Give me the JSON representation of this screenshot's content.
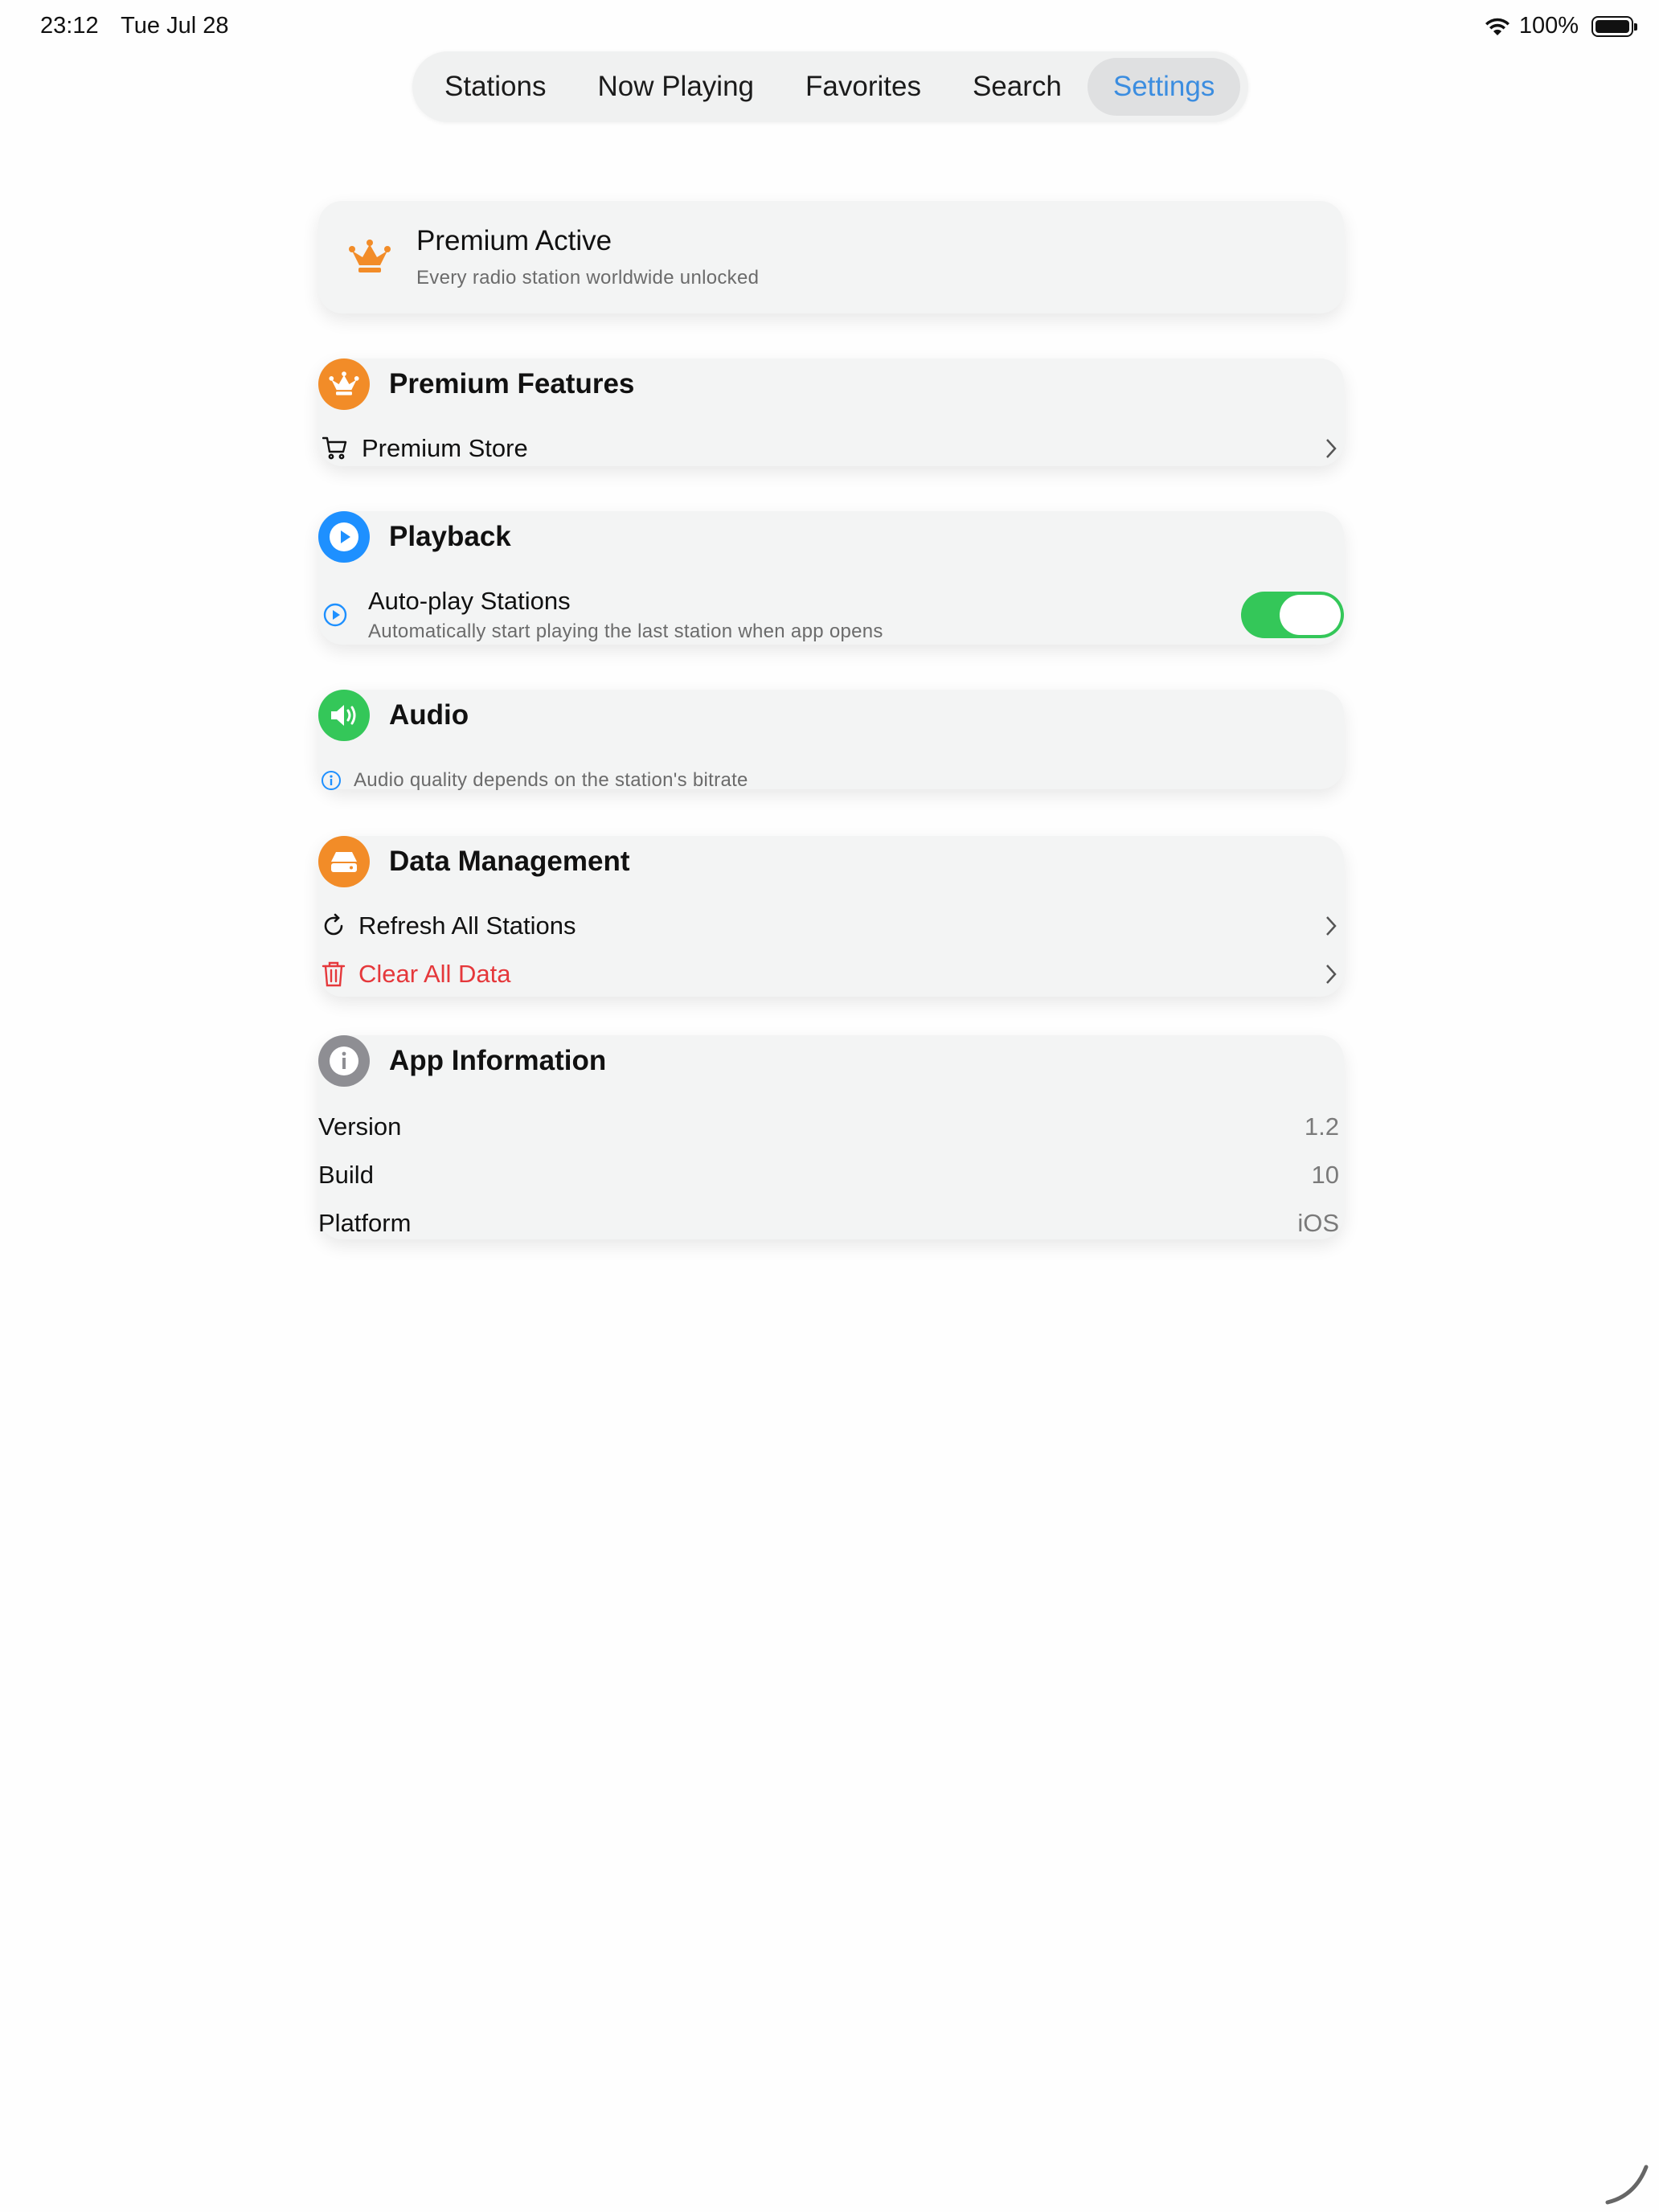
{
  "status_bar": {
    "time": "23:12",
    "date": "Tue Jul 28",
    "battery": "100%"
  },
  "tabs": [
    {
      "label": "Stations"
    },
    {
      "label": "Now Playing"
    },
    {
      "label": "Favorites"
    },
    {
      "label": "Search"
    },
    {
      "label": "Settings",
      "active": true
    }
  ],
  "premium_banner": {
    "title": "Premium Active",
    "subtitle": "Every radio station worldwide unlocked"
  },
  "sections": {
    "premium_features": {
      "title": "Premium Features",
      "store_label": "Premium Store"
    },
    "playback": {
      "title": "Playback",
      "autoplay_label": "Auto-play Stations",
      "autoplay_desc": "Automatically start playing the last station when app opens",
      "autoplay_on": true
    },
    "audio": {
      "title": "Audio",
      "note": "Audio quality depends on the station's bitrate"
    },
    "data_management": {
      "title": "Data Management",
      "refresh_label": "Refresh All Stations",
      "clear_label": "Clear All Data"
    },
    "app_info": {
      "title": "App Information",
      "rows": [
        {
          "label": "Version",
          "value": "1.2"
        },
        {
          "label": "Build",
          "value": "10"
        },
        {
          "label": "Platform",
          "value": "iOS"
        }
      ]
    }
  },
  "colors": {
    "accent": "#3b8de0",
    "orange": "#f28c28",
    "blue": "#1e90ff",
    "green": "#34c759",
    "danger": "#e5383b",
    "gray": "#8e8e93"
  }
}
